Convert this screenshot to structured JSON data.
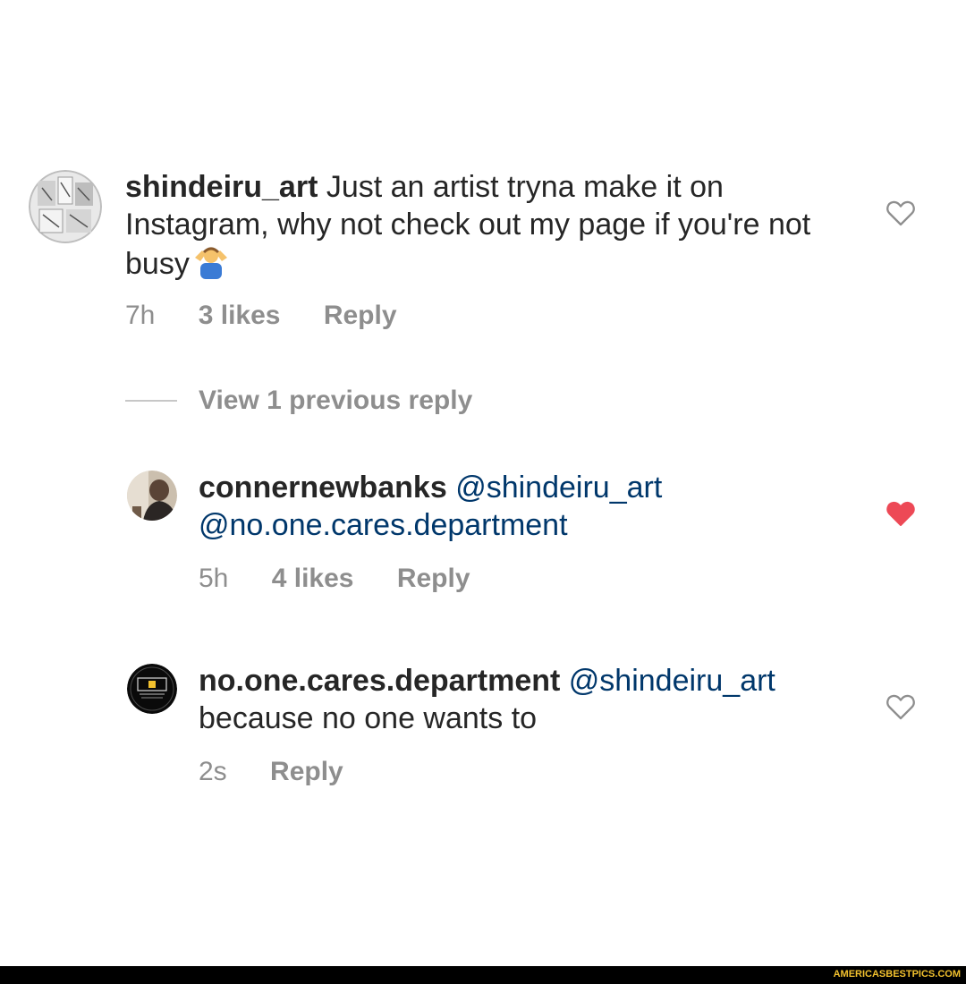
{
  "comments": [
    {
      "username": "shindeiru_art",
      "text": "Just an artist tryna make it on Instagram, why not check out my page if you're not busy",
      "emoji": "person-shrugging-emoji",
      "time": "7h",
      "likes": "3 likes",
      "reply_label": "Reply",
      "liked": false
    },
    {
      "username": "connernewbanks",
      "mention1": "@shindeiru_art",
      "mention2": "@no.one.cares.department",
      "time": "5h",
      "likes": "4 likes",
      "reply_label": "Reply",
      "liked": true
    },
    {
      "username": "no.one.cares.department",
      "mention": "@shindeiru_art",
      "text": "because no one wants to",
      "time": "2s",
      "reply_label": "Reply",
      "liked": false
    }
  ],
  "view_replies_label": "View 1 previous reply",
  "colors": {
    "text": "#262626",
    "mention": "#00376b",
    "meta": "#8e8e8e",
    "liked_heart": "#ed4956"
  },
  "watermark": "AMERICASBESTPICS.COM"
}
